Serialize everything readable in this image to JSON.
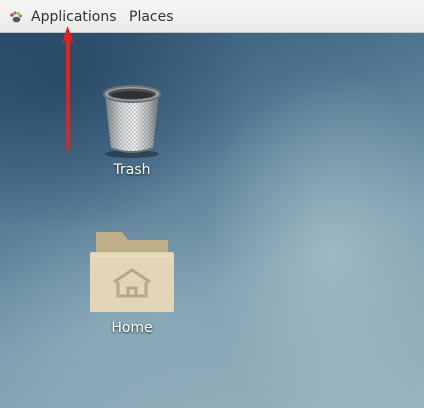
{
  "topbar": {
    "applications_label": "Applications",
    "places_label": "Places",
    "applications_icon": "gnome-foot-icon"
  },
  "desktop": {
    "icons": [
      {
        "label": "Trash",
        "icon": "trash-icon"
      },
      {
        "label": "Home",
        "icon": "home-folder-icon"
      }
    ]
  },
  "colors": {
    "annotation_arrow": "#e8211b",
    "topbar_bg": "#efefed",
    "folder": "#ddcfae"
  }
}
